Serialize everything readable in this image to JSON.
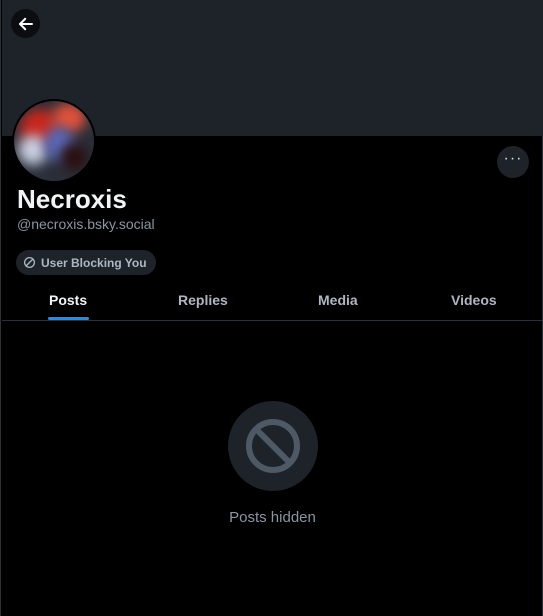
{
  "profile": {
    "display_name": "Necroxis",
    "handle": "@necroxis.bsky.social",
    "block_label": "User Blocking You"
  },
  "tabs": [
    {
      "label": "Posts",
      "active": true
    },
    {
      "label": "Replies",
      "active": false
    },
    {
      "label": "Media",
      "active": false
    },
    {
      "label": "Videos",
      "active": false
    }
  ],
  "empty_state": {
    "message": "Posts hidden",
    "icon": "blocked-circle-icon"
  },
  "icons": {
    "back": "arrow-left-icon",
    "more": "ellipsis-icon",
    "block": "block-icon"
  },
  "colors": {
    "background": "#000000",
    "banner": "#1e2329",
    "accent": "#208bfe",
    "muted_text": "#8a96a3"
  }
}
